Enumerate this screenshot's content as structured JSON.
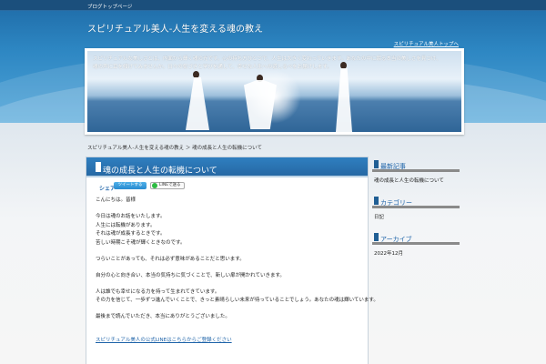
{
  "topbar": {
    "text": "ブログトップページ"
  },
  "site": {
    "title": "スピリチュアル美人-人生を変える魂の教え",
    "subtitle_link": "スピリチュアル美人トップへ"
  },
  "hero": {
    "description_line1": "スピリチュアルな美しさとは、内面から輝く魂の光です。心の持ち方ひとつで、人生は大きく変わっていきます。あなたの中に眠る本当の美しさを見つけ、",
    "description_line2": "魂の声に耳を傾けてみませんか。日々の気づきと学びを通して、幸せな人生への道しるべをお届けします。"
  },
  "breadcrumb": "スピリチュアル美人-人生を変える魂の教え ＞ 魂の成長と人生の転機について",
  "post": {
    "title": "魂の成長と人生の転機について",
    "share_label": "シェア",
    "share_button": "ツイートする",
    "line_button": "LINEで送る",
    "lines": [
      "こんにちは。皆様",
      "",
      "今日は魂のお話をいたします。",
      "人生には転機があります。",
      "それは魂が成長するときです。",
      "苦しい時期こそ魂が輝くときなのです。",
      "",
      "つらいことがあっても、それは必ず意味があることだと思います。",
      "",
      "自分の心と向き合い、本当の気持ちに気づくことで、新しい扉が開かれていきます。",
      "",
      "人は誰でも幸せになる力を持って生まれてきています。",
      "その力を信じて、一歩ずつ進んでいくことで、きっと素晴らしい未来が待っていることでしょう。あなたの魂は輝いています。",
      "",
      "最後まで読んでいただき、本当にありがとうございました。",
      ""
    ],
    "link_text": "スピリチュアル美人の公式LINEはこちらからご登録ください"
  },
  "sidebar": {
    "widgets": [
      {
        "title": "最新記事",
        "body": "魂の成長と人生の転機について"
      },
      {
        "title": "カテゴリー",
        "body": "日記"
      },
      {
        "title": "アーカイブ",
        "body": "2022年12月"
      }
    ]
  }
}
